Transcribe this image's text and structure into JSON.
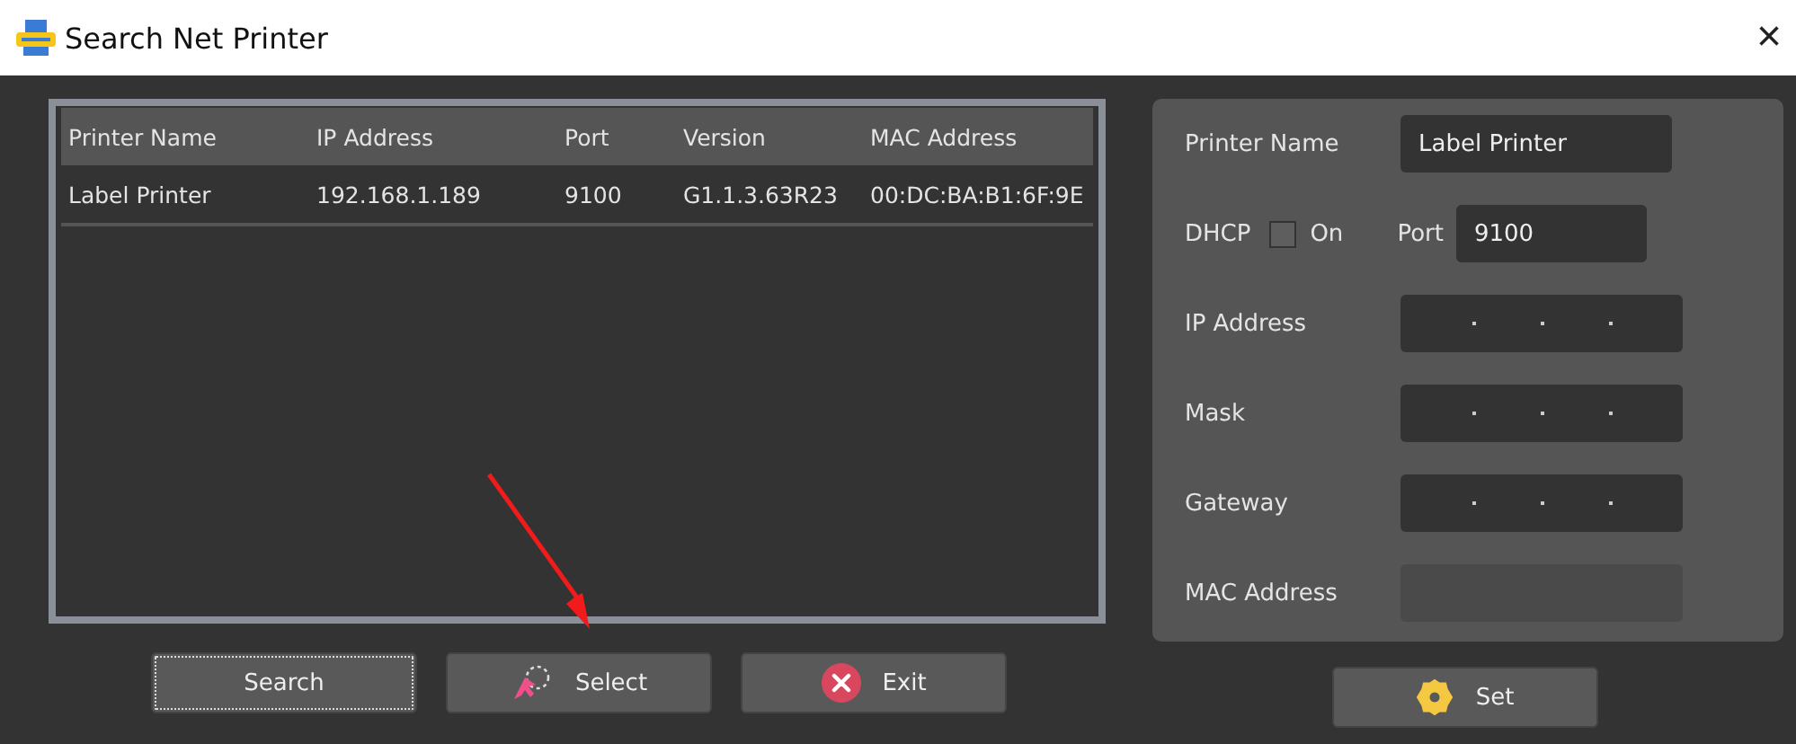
{
  "window": {
    "title": "Search Net Printer",
    "close": "×"
  },
  "table": {
    "columns": [
      "Printer Name",
      "IP Address",
      "Port",
      "Version",
      "MAC Address"
    ],
    "rows": [
      [
        "Label Printer",
        "192.168.1.189",
        "9100",
        "G1.1.3.63R23",
        "00:DC:BA:B1:6F:9E"
      ]
    ]
  },
  "settings": {
    "printer_name": {
      "label": "Printer Name",
      "value": "Label Printer"
    },
    "dhcp": {
      "label": "DHCP",
      "option": "On",
      "checked": false
    },
    "port": {
      "label": "Port",
      "value": "9100"
    },
    "ip_fields": [
      {
        "label": "IP Address"
      },
      {
        "label": "Mask"
      },
      {
        "label": "Gateway"
      }
    ],
    "mac": {
      "label": "MAC Address"
    }
  },
  "buttons": [
    {
      "label": "Search",
      "kind": "plain"
    },
    {
      "label": "Select",
      "kind": "select"
    },
    {
      "label": "Exit",
      "kind": "exit"
    }
  ],
  "set_button": {
    "label": "Set"
  }
}
